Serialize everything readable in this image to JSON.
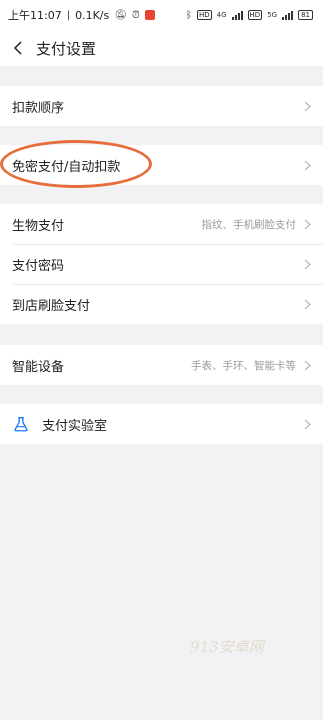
{
  "status_bar": {
    "time": "上午11:07",
    "net_speed": "0.1K/s",
    "tags": [
      "HD",
      "HD"
    ],
    "net_types": [
      "4G",
      "5G"
    ],
    "battery": "81"
  },
  "header": {
    "title": "支付设置"
  },
  "sections": [
    {
      "items": [
        {
          "label": "扣款顺序",
          "value": ""
        }
      ]
    },
    {
      "items": [
        {
          "label": "免密支付/自动扣款",
          "value": ""
        }
      ]
    },
    {
      "items": [
        {
          "label": "生物支付",
          "value": "指纹、手机刷脸支付"
        },
        {
          "label": "支付密码",
          "value": ""
        },
        {
          "label": "到店刷脸支付",
          "value": ""
        }
      ]
    },
    {
      "items": [
        {
          "label": "智能设备",
          "value": "手表、手环、智能卡等"
        }
      ]
    },
    {
      "items": [
        {
          "label": "支付实验室",
          "value": ""
        }
      ]
    }
  ],
  "annotation_color": "#e86d3c",
  "accent_lab_icon": "#1677ff",
  "watermark": "913安卓网"
}
